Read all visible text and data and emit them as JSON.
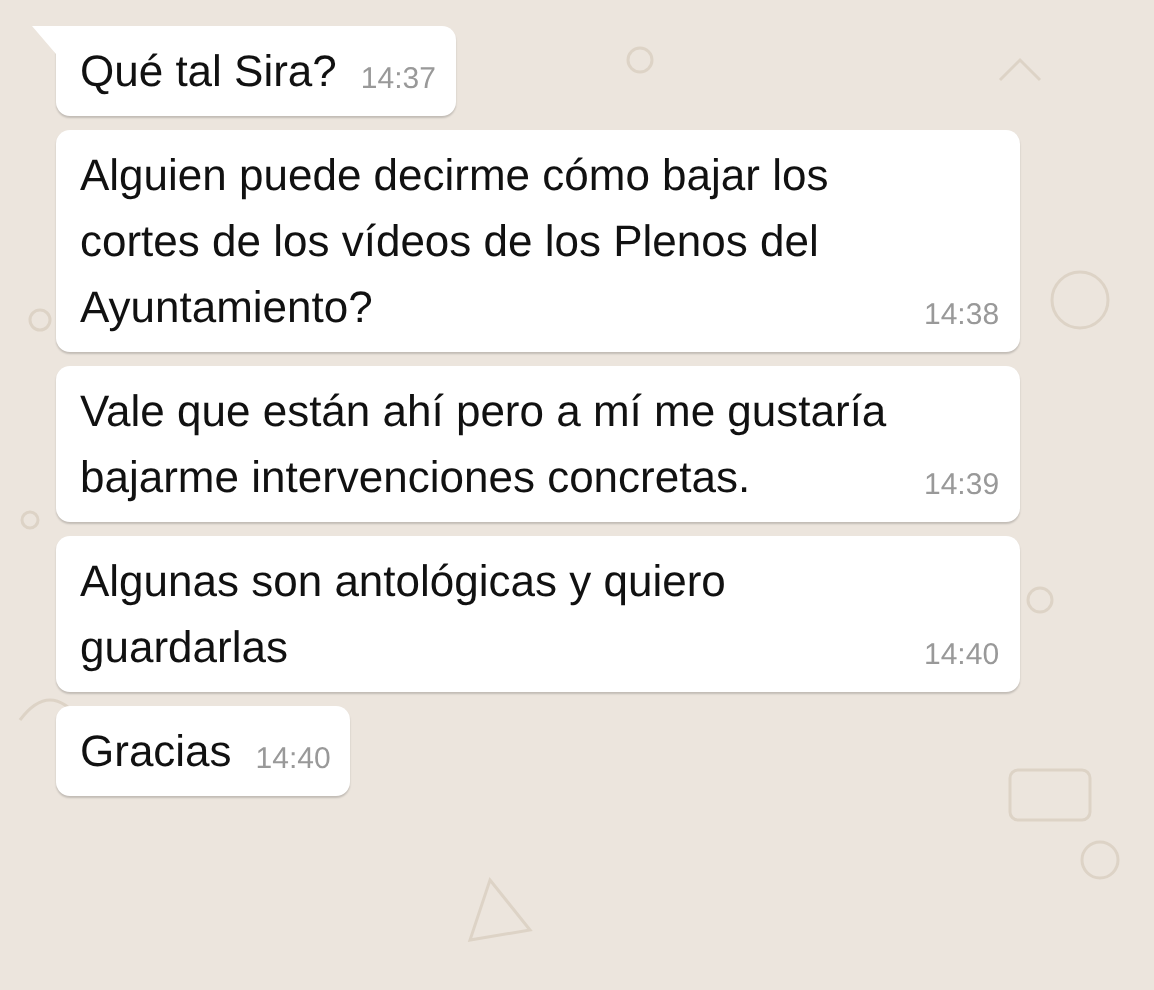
{
  "messages": [
    {
      "text": "Qué tal Sira?",
      "time": "14:37",
      "tail": true
    },
    {
      "text": "Alguien puede decirme cómo bajar los cortes de los vídeos de los Plenos del Ayuntamiento?",
      "time": "14:38",
      "tail": false
    },
    {
      "text": "Vale que están ahí pero a mí me gustaría bajarme intervenciones concretas.",
      "time": "14:39",
      "tail": false
    },
    {
      "text": "Algunas son antológicas y quiero guardarlas",
      "time": "14:40",
      "tail": false
    },
    {
      "text": "Gracias",
      "time": "14:40",
      "tail": false
    }
  ]
}
